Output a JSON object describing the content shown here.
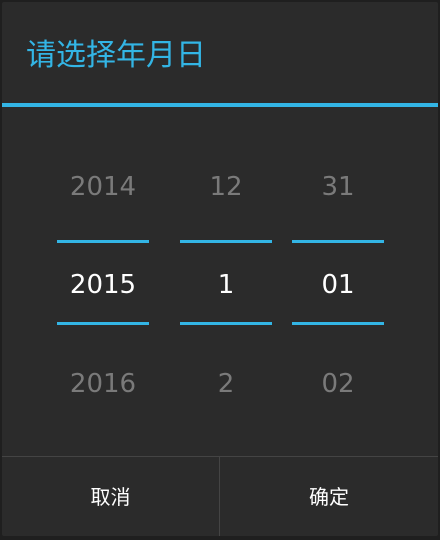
{
  "dialog": {
    "title": "请选择年月日"
  },
  "picker": {
    "year": {
      "prev": "2014",
      "current": "2015",
      "next": "2016"
    },
    "month": {
      "prev": "12",
      "current": "1",
      "next": "2"
    },
    "day": {
      "prev": "31",
      "current": "01",
      "next": "02"
    }
  },
  "buttons": {
    "cancel_label": "取消",
    "confirm_label": "确定"
  },
  "colors": {
    "accent": "#33b5e5",
    "background": "#2b2b2b",
    "text_selected": "#ffffff",
    "text_dim": "#7a7a7a"
  }
}
